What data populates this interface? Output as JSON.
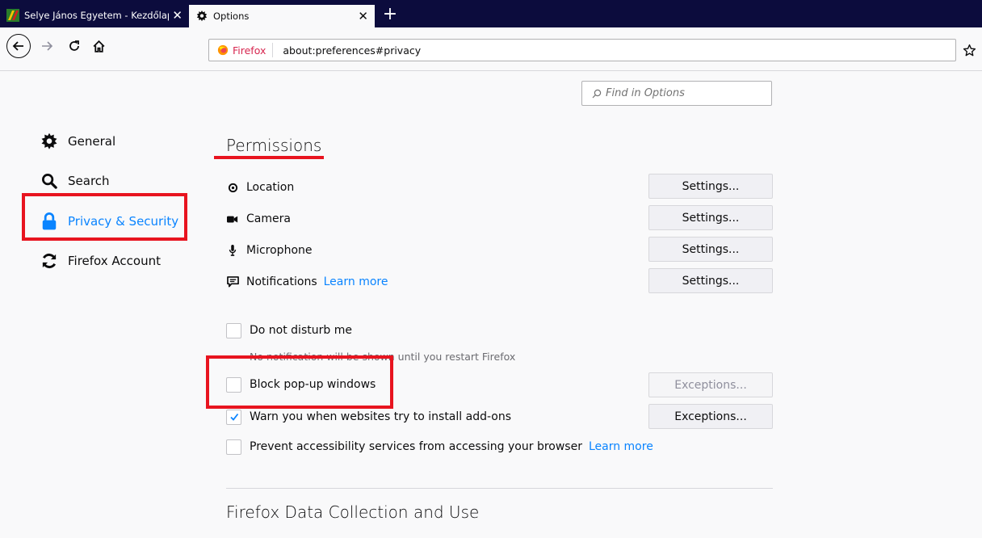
{
  "tabs": [
    {
      "title": "Selye János Egyetem - Kezdőlap",
      "close": "✕"
    },
    {
      "title": "Options",
      "close": "✕"
    }
  ],
  "new_tab": "+",
  "urlbar": {
    "identity": "Firefox",
    "url": "about:preferences#privacy"
  },
  "find": {
    "placeholder": "Find in Options"
  },
  "sidebar": {
    "items": [
      {
        "label": "General",
        "icon": "gear-icon"
      },
      {
        "label": "Search",
        "icon": "search-icon"
      },
      {
        "label": "Privacy & Security",
        "icon": "lock-icon",
        "selected": true
      },
      {
        "label": "Firefox Account",
        "icon": "sync-icon"
      }
    ]
  },
  "permissions": {
    "heading": "Permissions",
    "rows": [
      {
        "label": "Location",
        "button": "Settings..."
      },
      {
        "label": "Camera",
        "button": "Settings..."
      },
      {
        "label": "Microphone",
        "button": "Settings..."
      },
      {
        "label": "Notifications",
        "link": "Learn more",
        "button": "Settings..."
      }
    ],
    "do_not_disturb": {
      "label": "Do not disturb me",
      "checked": false
    },
    "dnd_note": "No notification will be shown until you restart Firefox",
    "block_popups": {
      "label": "Block pop-up windows",
      "checked": false,
      "button": "Exceptions..."
    },
    "warn_addons": {
      "label": "Warn you when websites try to install add-ons",
      "checked": true,
      "button": "Exceptions..."
    },
    "prevent_a11y": {
      "label": "Prevent accessibility services from accessing your browser",
      "link": "Learn more",
      "checked": false
    }
  },
  "data_collection": {
    "heading": "Firefox Data Collection and Use"
  },
  "colors": {
    "accent": "#0a84ff",
    "annotation": "#e8141f",
    "tabstrip": "#0c0c3d"
  }
}
